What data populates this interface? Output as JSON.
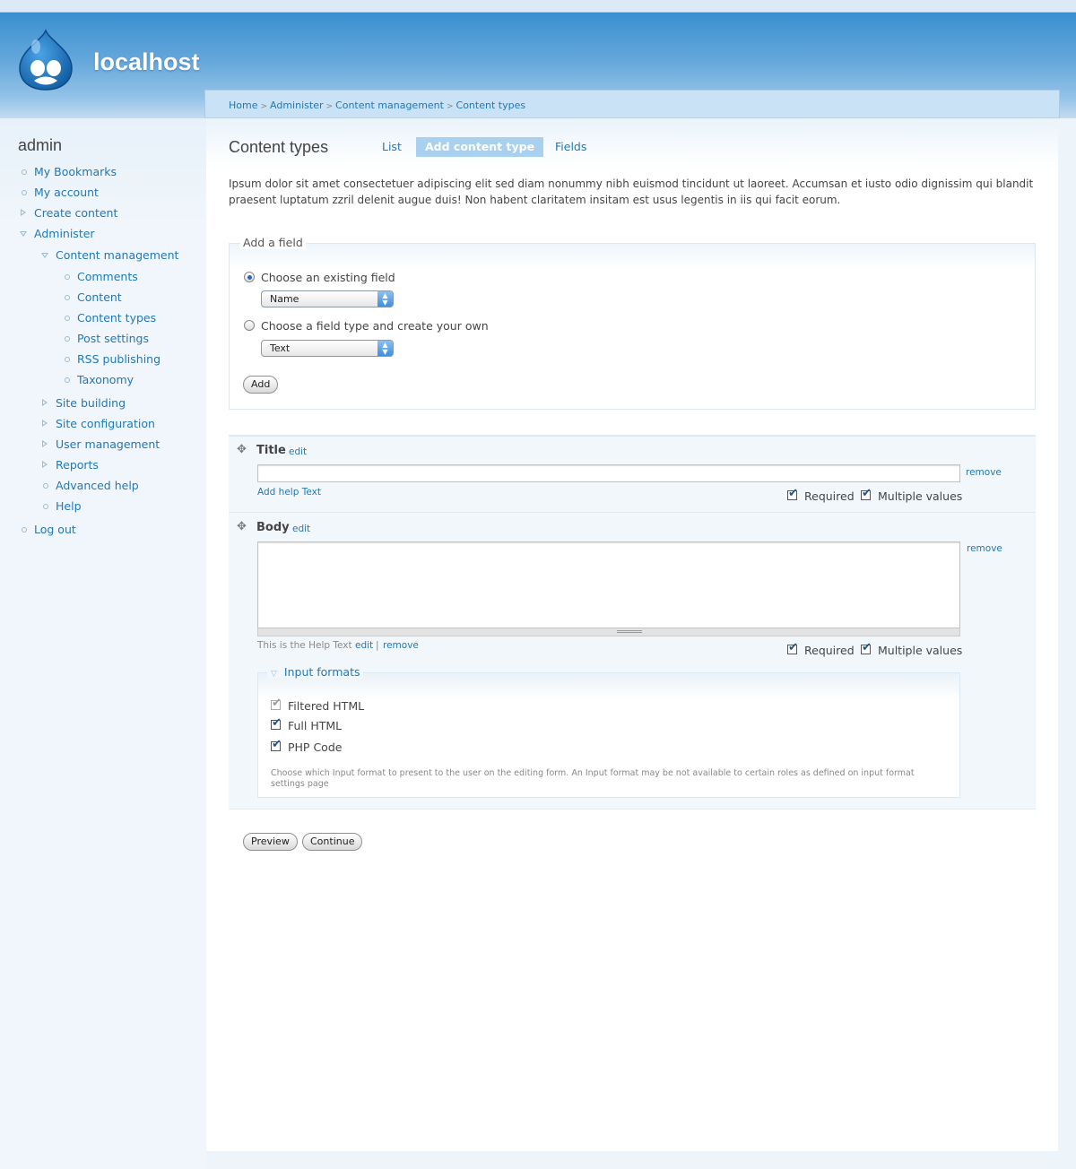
{
  "site": {
    "name": "localhost"
  },
  "sidebar": {
    "title": "admin",
    "items": [
      {
        "label": "My Bookmarks"
      },
      {
        "label": "My account"
      },
      {
        "label": "Create content"
      },
      {
        "label": "Administer"
      },
      {
        "label": "Content management"
      },
      {
        "label": "Comments"
      },
      {
        "label": "Content"
      },
      {
        "label": "Content types"
      },
      {
        "label": "Post settings"
      },
      {
        "label": "RSS publishing"
      },
      {
        "label": "Taxonomy"
      },
      {
        "label": "Site building"
      },
      {
        "label": "Site configuration"
      },
      {
        "label": "User management"
      },
      {
        "label": "Reports"
      },
      {
        "label": "Advanced help"
      },
      {
        "label": "Help"
      },
      {
        "label": "Log out"
      }
    ]
  },
  "breadcrumb": [
    "Home",
    "Administer",
    "Content management",
    "Content types"
  ],
  "breadcrumb_sep": ">",
  "page": {
    "title": "Content types",
    "tabs": [
      "List",
      "Add content type",
      "Fields"
    ],
    "intro": "Ipsum dolor sit amet consectetuer adipiscing elit sed diam nonummy nibh euismod tincidunt ut laoreet. Accumsan et iusto odio dignissim qui blandit praesent luptatum zzril delenit augue duis! Non habent claritatem insitam est usus legentis in iis qui facit eorum."
  },
  "add_field": {
    "legend": "Add a field",
    "option_existing": "Choose an existing field",
    "existing_value": "Name",
    "option_new": "Choose a field type and create your own",
    "new_value": "Text",
    "add_button": "Add"
  },
  "fields": {
    "title": {
      "name": "Title",
      "edit": "edit",
      "remove": "remove",
      "help_link": "Add help Text",
      "required": "Required",
      "multiple": "Multiple values"
    },
    "body": {
      "name": "Body",
      "edit": "edit",
      "remove": "remove",
      "help_text": "This is the Help Text",
      "help_edit": "edit",
      "help_sep": "|",
      "help_remove": "remove",
      "required": "Required",
      "multiple": "Multiple values"
    }
  },
  "input_formats": {
    "legend": "Input formats",
    "options": [
      "Filtered HTML",
      "Full HTML",
      "PHP Code"
    ],
    "note": "Choose which Input format to present to the user on the editing form. An Input format may be not available to certain roles as defined on input format settings page"
  },
  "buttons": {
    "preview": "Preview",
    "continue": "Continue"
  },
  "colors": {
    "link": "#2278b8",
    "header": "#3a8fd0",
    "active_tab": "#a9d0ef"
  }
}
